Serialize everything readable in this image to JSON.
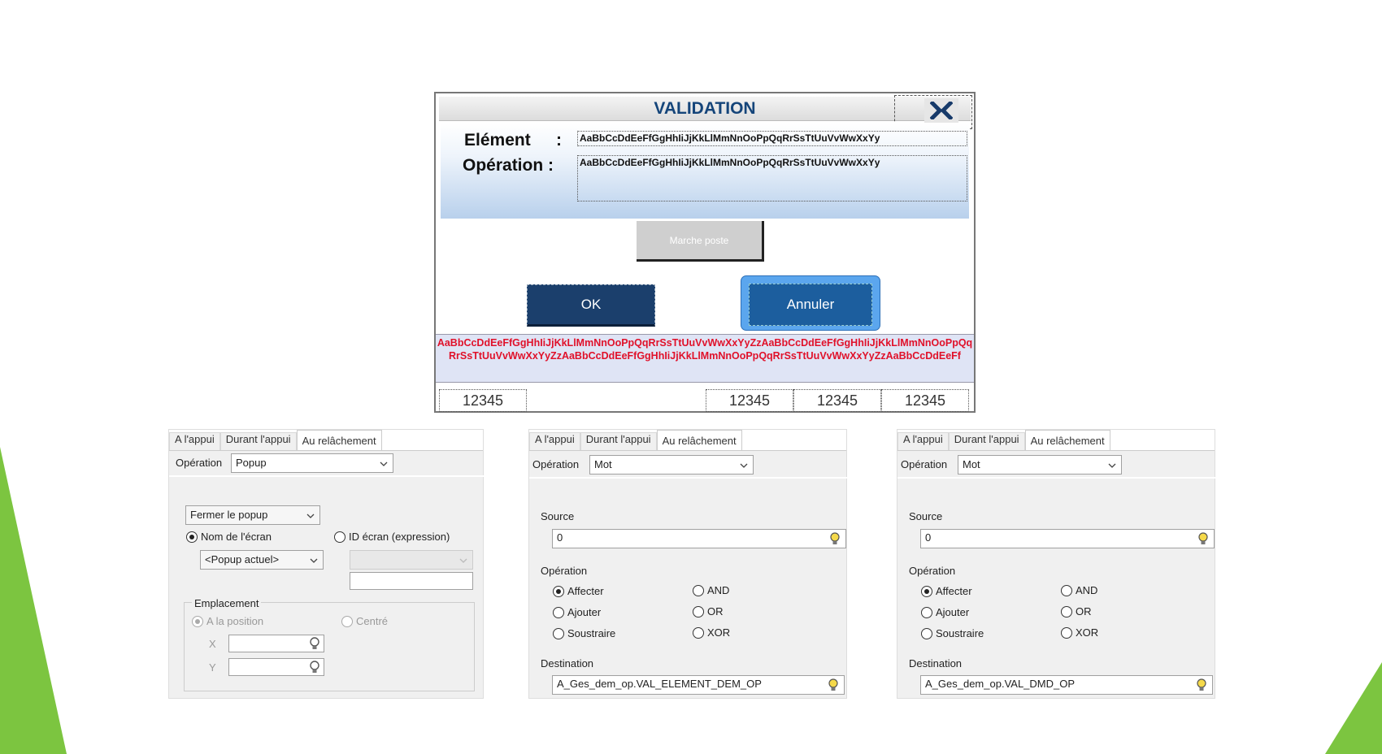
{
  "colors": {
    "accent_green": "#7cc540",
    "dialog_title": "#15457a",
    "red_text": "#e0112a"
  },
  "popup": {
    "title": "VALIDATION",
    "element_label": "Elément",
    "element_colon": ":",
    "operation_label": "Opération :",
    "element_value": "AaBbCcDdEeFfGgHhIiJjKkLlMmNnOoPpQqRrSsTtUuVvWwXxYy",
    "operation_value": "AaBbCcDdEeFfGgHhIiJjKkLlMmNnOoPpQqRrSsTtUuVvWwXxYy",
    "marche_button": "Marche poste",
    "ok_button": "OK",
    "annuler_button": "Annuler",
    "red_message": "AaBbCcDdEeFfGgHhIiJjKkLlMmNnOoPpQqRrSsTtUuVvWwXxYyZzAaBbCcDdEeFfGgHhIiJjKkLlMmNnOoPpQqRrSsTtUuVvWwXxYyZzAaBbCcDdEeFfGgHhIiJjKkLlMmNnOoPpQqRrSsTtUuVvWwXxYyZzAaBbCcDdEeFf",
    "footer_values": [
      "12345",
      "12345",
      "12345",
      "12345"
    ],
    "close_icon": "x-close-icon"
  },
  "tabs": [
    "A l'appui",
    "Durant l'appui",
    "Au relâchement"
  ],
  "panel_popup": {
    "operation_label": "Opération",
    "operation_value": "Popup",
    "action_value": "Fermer le popup",
    "radio_nom": "Nom de l'écran",
    "radio_id": "ID écran (expression)",
    "screen_value": "<Popup actuel>",
    "emplacement_label": "Emplacement",
    "radio_position": "A la position",
    "radio_centre": "Centré",
    "x_label": "X",
    "y_label": "Y"
  },
  "panel_mot_1": {
    "operation_label": "Opération",
    "operation_value": "Mot",
    "source_label": "Source",
    "source_value": "0",
    "operation_group_label": "Opération",
    "radios": [
      "Affecter",
      "Ajouter",
      "Soustraire",
      "AND",
      "OR",
      "XOR"
    ],
    "destination_label": "Destination",
    "destination_value": "A_Ges_dem_op.VAL_ELEMENT_DEM_OP"
  },
  "panel_mot_2": {
    "operation_label": "Opération",
    "operation_value": "Mot",
    "source_label": "Source",
    "source_value": "0",
    "operation_group_label": "Opération",
    "radios": [
      "Affecter",
      "Ajouter",
      "Soustraire",
      "AND",
      "OR",
      "XOR"
    ],
    "destination_label": "Destination",
    "destination_value": "A_Ges_dem_op.VAL_DMD_OP"
  }
}
